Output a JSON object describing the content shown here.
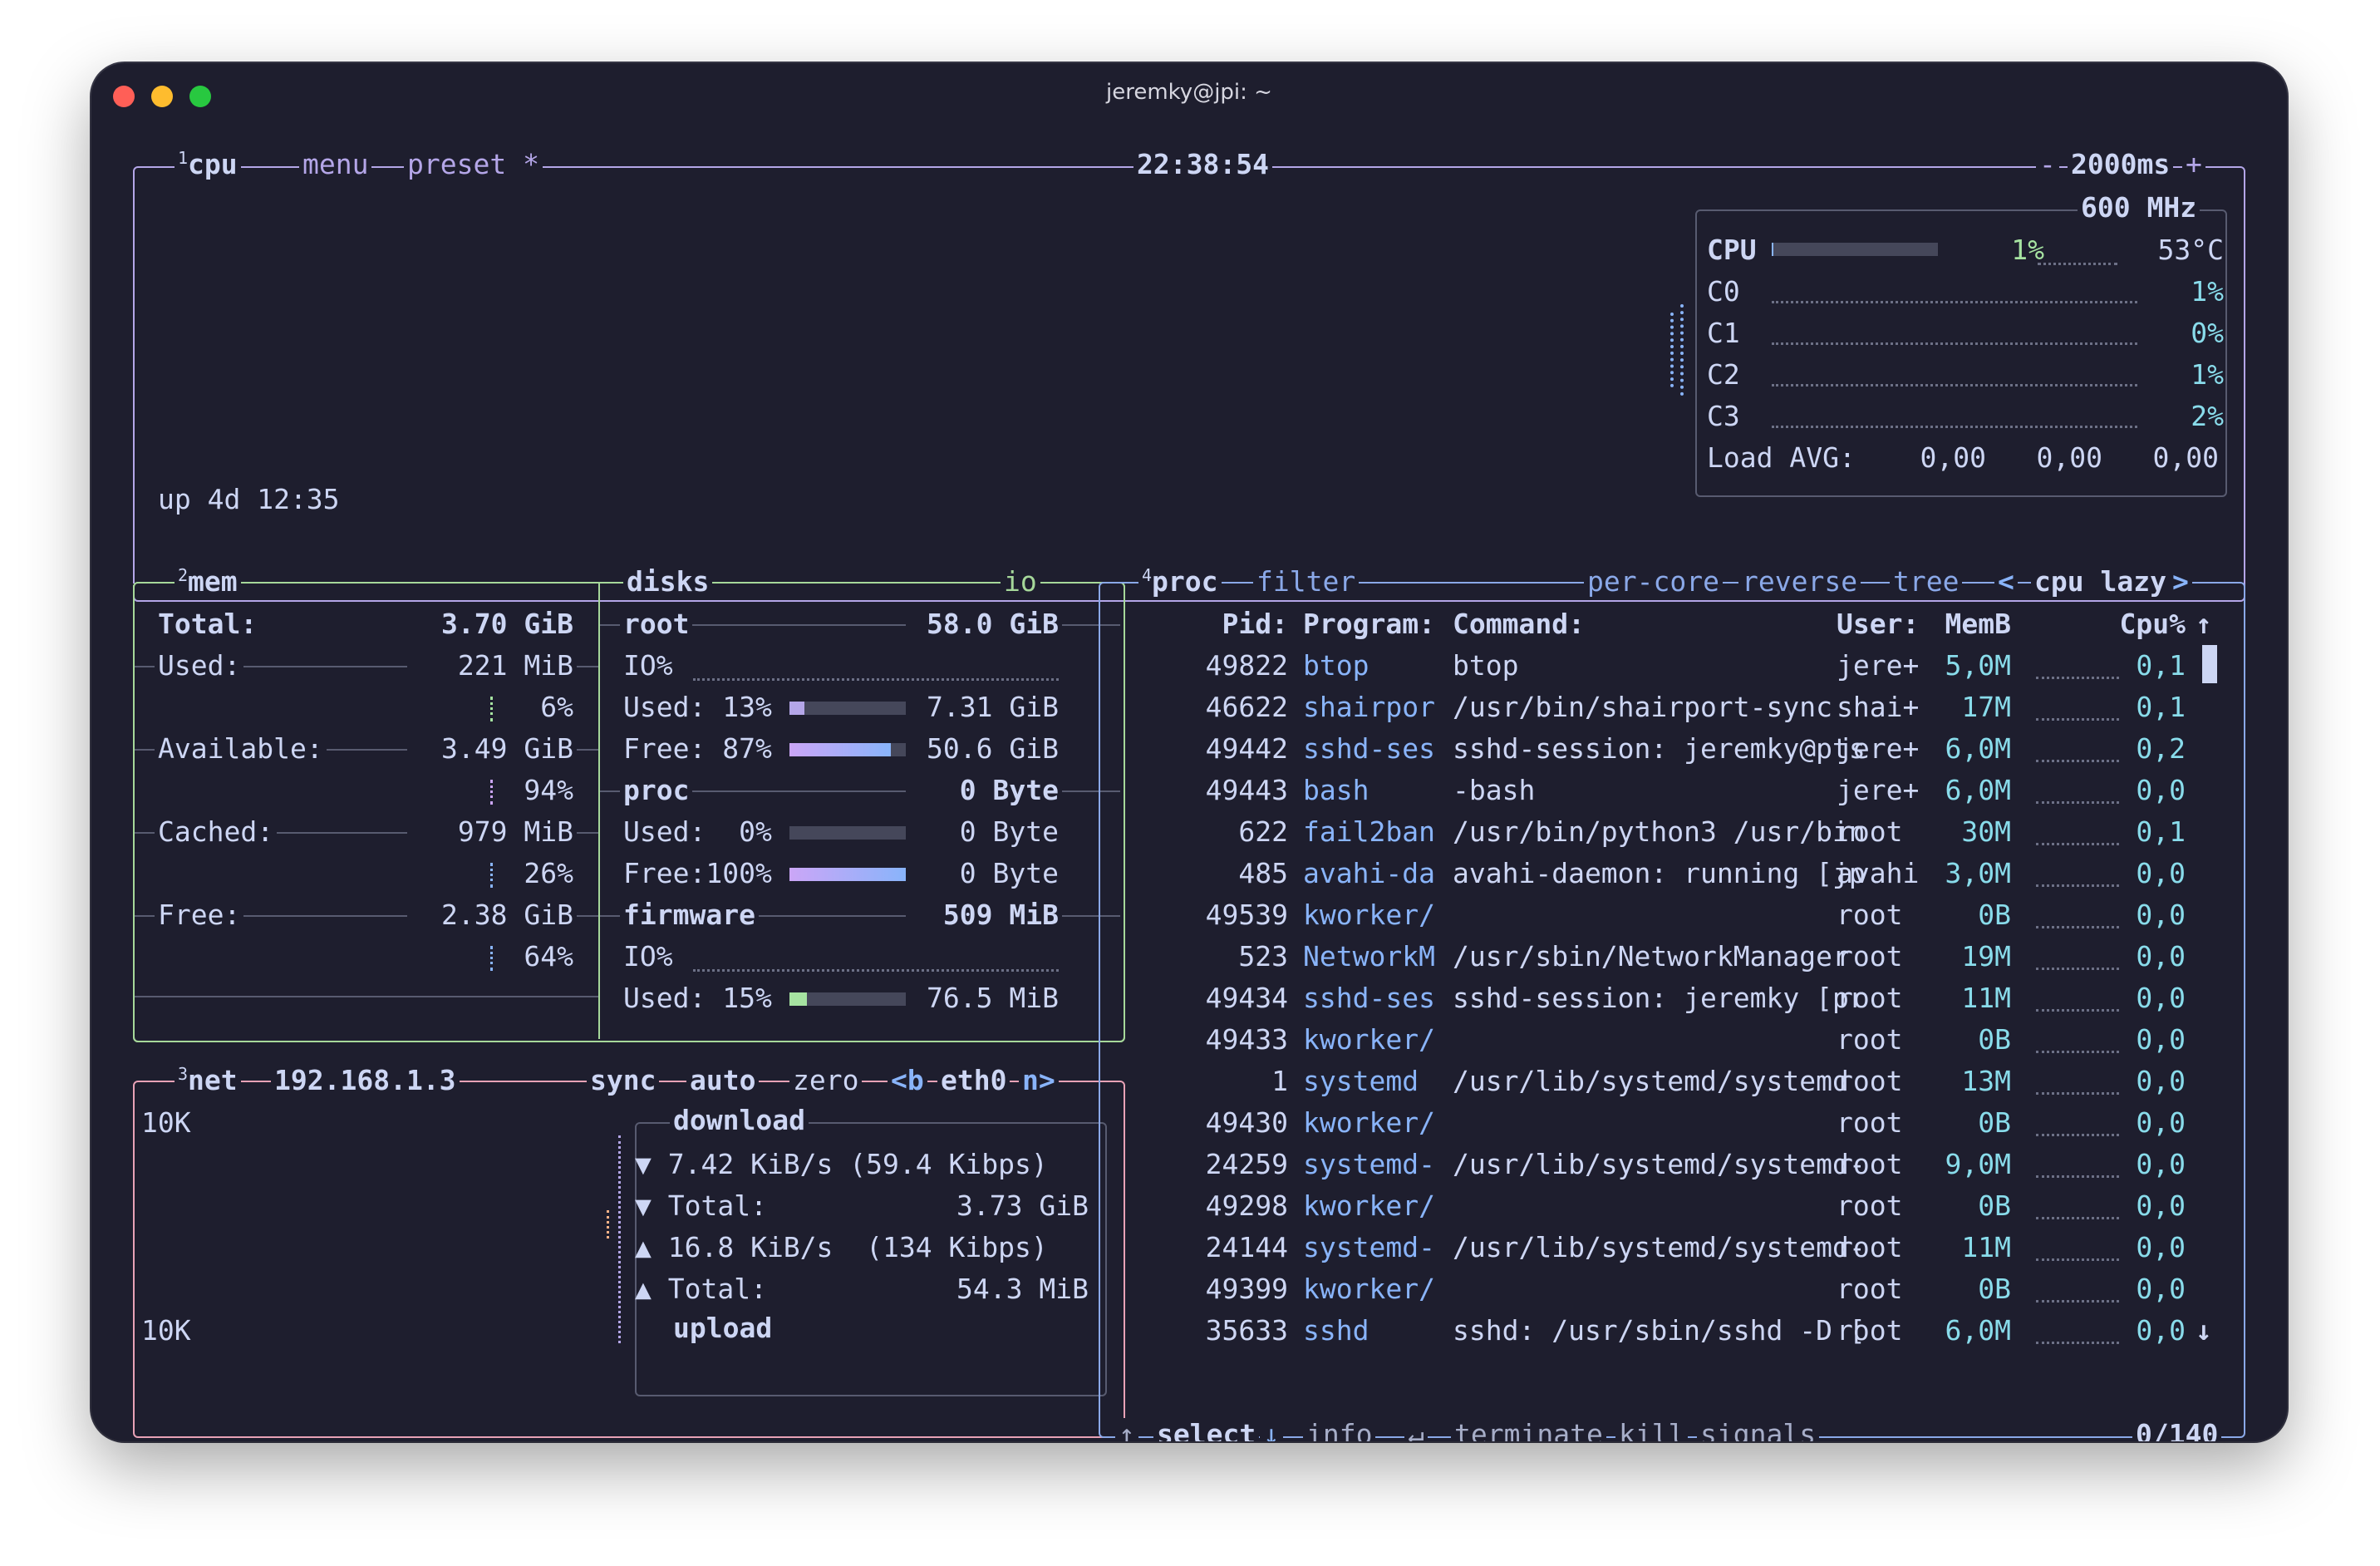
{
  "window": {
    "title": "jeremky@jpi: ~",
    "colors": {
      "bg": "#1e1e2e",
      "cpu_border": "#b4a6e8",
      "mem_border": "#a6d89a",
      "net_border": "#e8a2b6",
      "proc_border": "#8aa8e8"
    }
  },
  "cpu": {
    "index": "1",
    "title": "cpu",
    "menu_label": "menu",
    "preset_label": "preset *",
    "clock": "22:38:54",
    "interval_minus": "-",
    "interval": "2000ms",
    "interval_plus": "+",
    "freq": "600 MHz",
    "uptime": "up 4d 12:35",
    "total": {
      "label": "CPU",
      "percent": "1%",
      "temp": "53°C",
      "bar_fraction": 0.01
    },
    "cores": [
      {
        "label": "C0",
        "percent": "1%"
      },
      {
        "label": "C1",
        "percent": "0%"
      },
      {
        "label": "C2",
        "percent": "1%"
      },
      {
        "label": "C3",
        "percent": "2%"
      }
    ],
    "load_label": "Load AVG:",
    "load": [
      "0,00",
      "0,00",
      "0,00"
    ]
  },
  "mem": {
    "index": "2",
    "title": "mem",
    "total_label": "Total:",
    "total_value": "3.70 GiB",
    "rows": [
      {
        "label": "Used:",
        "value": "221 MiB",
        "percent": "6%"
      },
      {
        "label": "Available:",
        "value": "3.49 GiB",
        "percent": "94%"
      },
      {
        "label": "Cached:",
        "value": "979 MiB",
        "percent": "26%"
      },
      {
        "label": "Free:",
        "value": "2.38 GiB",
        "percent": "64%"
      }
    ]
  },
  "disks": {
    "title": "disks",
    "io_label": "io",
    "root": {
      "name": "root",
      "size": "58.0 GiB",
      "io": "IO%",
      "used_label": "Used: 13%",
      "used_value": "7.31 GiB",
      "used_fraction": 0.13,
      "free_label": "Free: 87%",
      "free_value": "50.6 GiB",
      "free_fraction": 0.87
    },
    "proc": {
      "name": "proc",
      "size": "0 Byte",
      "used_label": "Used:  0%",
      "used_value": "0 Byte",
      "used_fraction": 0.0,
      "free_label": "Free:100%",
      "free_value": "0 Byte",
      "free_fraction": 1.0
    },
    "firmware": {
      "name": "firmware",
      "size": "509 MiB",
      "io": "IO%",
      "used_label": "Used: 15%",
      "used_value": "76.5 MiB",
      "used_fraction": 0.15
    }
  },
  "net": {
    "index": "3",
    "title": "net",
    "ip": "192.168.1.3",
    "sync": "sync",
    "auto": "auto",
    "zero": "zero",
    "prev_iface": "<b",
    "iface": "eth0",
    "next_iface": "n>",
    "scale_top": "10K",
    "scale_bottom": "10K",
    "download_label": "download",
    "upload_label": "upload",
    "down_rate": "▼ 7.42 KiB/s (59.4 Kibps)",
    "down_total_label": "▼ Total:",
    "down_total": "3.73 GiB",
    "up_rate": "▲ 16.8 KiB/s  (134 Kibps)",
    "up_total_label": "▲ Total:",
    "up_total": "54.3 MiB"
  },
  "proc": {
    "index": "4",
    "title": "proc",
    "filter_label": "filter",
    "per_core_label": "per-core",
    "reverse_label": "reverse",
    "tree_label": "tree",
    "sort_prev": "<",
    "sort_label": "cpu lazy",
    "sort_next": ">",
    "headers": {
      "pid": "Pid:",
      "program": "Program:",
      "command": "Command:",
      "user": "User:",
      "mem": "MemB",
      "cpu": "Cpu%"
    },
    "rows": [
      {
        "pid": "49822",
        "program": "btop",
        "command": "btop",
        "user": "jere+",
        "mem": "5,0M",
        "cpu": "0,1"
      },
      {
        "pid": "46622",
        "program": "shairpor",
        "command": "/usr/bin/shairport-sync",
        "user": "shai+",
        "mem": "17M",
        "cpu": "0,1"
      },
      {
        "pid": "49442",
        "program": "sshd-ses",
        "command": "sshd-session: jeremky@pts",
        "user": "jere+",
        "mem": "6,0M",
        "cpu": "0,2"
      },
      {
        "pid": "49443",
        "program": "bash",
        "command": "-bash",
        "user": "jere+",
        "mem": "6,0M",
        "cpu": "0,0"
      },
      {
        "pid": "622",
        "program": "fail2ban",
        "command": "/usr/bin/python3 /usr/bin",
        "user": "root",
        "mem": "30M",
        "cpu": "0,1"
      },
      {
        "pid": "485",
        "program": "avahi-da",
        "command": "avahi-daemon: running [jp",
        "user": "avahi",
        "mem": "3,0M",
        "cpu": "0,0"
      },
      {
        "pid": "49539",
        "program": "kworker/",
        "command": "",
        "user": "root",
        "mem": "0B",
        "cpu": "0,0"
      },
      {
        "pid": "523",
        "program": "NetworkM",
        "command": "/usr/sbin/NetworkManager",
        "user": "root",
        "mem": "19M",
        "cpu": "0,0"
      },
      {
        "pid": "49434",
        "program": "sshd-ses",
        "command": "sshd-session: jeremky [pr",
        "user": "root",
        "mem": "11M",
        "cpu": "0,0"
      },
      {
        "pid": "49433",
        "program": "kworker/",
        "command": "",
        "user": "root",
        "mem": "0B",
        "cpu": "0,0"
      },
      {
        "pid": "1",
        "program": "systemd",
        "command": "/usr/lib/systemd/systemd",
        "user": "root",
        "mem": "13M",
        "cpu": "0,0"
      },
      {
        "pid": "49430",
        "program": "kworker/",
        "command": "",
        "user": "root",
        "mem": "0B",
        "cpu": "0,0"
      },
      {
        "pid": "24259",
        "program": "systemd-",
        "command": "/usr/lib/systemd/systemd-",
        "user": "root",
        "mem": "9,0M",
        "cpu": "0,0"
      },
      {
        "pid": "49298",
        "program": "kworker/",
        "command": "",
        "user": "root",
        "mem": "0B",
        "cpu": "0,0"
      },
      {
        "pid": "24144",
        "program": "systemd-",
        "command": "/usr/lib/systemd/systemd-",
        "user": "root",
        "mem": "11M",
        "cpu": "0,0"
      },
      {
        "pid": "49399",
        "program": "kworker/",
        "command": "",
        "user": "root",
        "mem": "0B",
        "cpu": "0,0"
      },
      {
        "pid": "35633",
        "program": "sshd",
        "command": "sshd: /usr/sbin/sshd -D [",
        "user": "root",
        "mem": "6,0M",
        "cpu": "0,0"
      }
    ],
    "footer": {
      "up_arrow": "↑",
      "select": "select",
      "down_arrow": "↓",
      "info": "info",
      "enter": "↵",
      "terminate": "terminate",
      "kill": "kill",
      "signals": "signals",
      "count": "0/140"
    },
    "scroll_up": "↑",
    "scroll_down": "↓"
  }
}
